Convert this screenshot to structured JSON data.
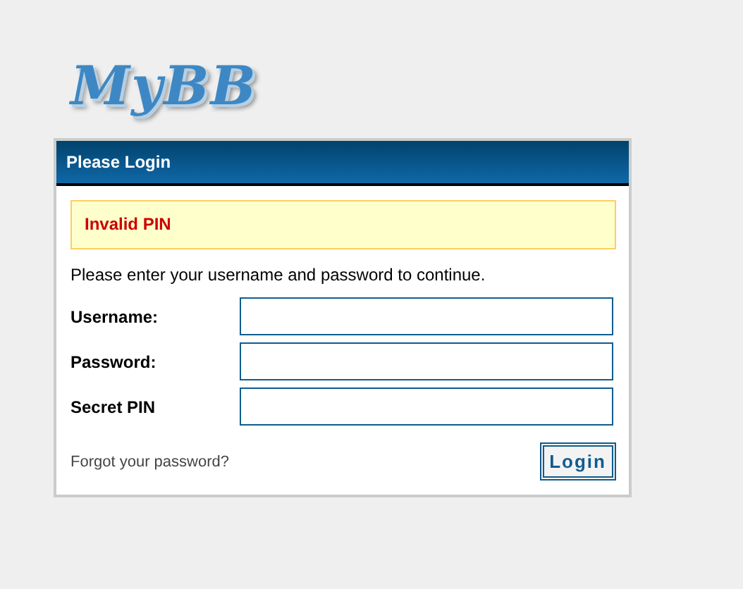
{
  "logo": "MyBB",
  "panel": {
    "title": "Please Login",
    "error": "Invalid PIN",
    "intro": "Please enter your username and password to continue.",
    "fields": [
      {
        "label": "Username:"
      },
      {
        "label": "Password:"
      },
      {
        "label": "Secret PIN"
      }
    ],
    "forgot_link": "Forgot your password?",
    "button": "Login"
  }
}
